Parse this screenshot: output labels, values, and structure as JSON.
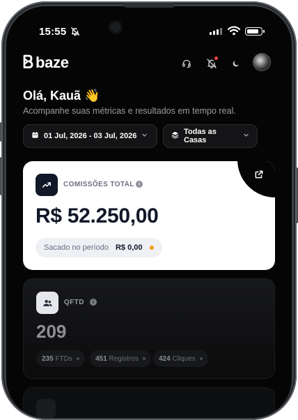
{
  "status_bar": {
    "time": "15:55"
  },
  "header": {
    "brand": "baze"
  },
  "greeting": {
    "title": "Olá, Kauã 👋",
    "subtitle": "Acompanhe suas métricas e resultados em tempo real."
  },
  "filters": {
    "date_range": "01 Jul, 2026 - 03 Jul, 2026",
    "casas": "Todas as Casas"
  },
  "commissions": {
    "label": "COMISSÕES TOTAL",
    "amount": "R$ 52.250,00",
    "withdrawn_label": "Sacado no período",
    "withdrawn_value": "R$ 0,00"
  },
  "qftd": {
    "label": "QFTD",
    "value": "209",
    "chips": [
      {
        "value": "235",
        "label": "FTDs"
      },
      {
        "value": "451",
        "label": "Registros"
      },
      {
        "value": "424",
        "label": "Cliques"
      }
    ]
  },
  "colors": {
    "background": "#050505",
    "card_light": "#ffffff",
    "accent_dot": "#f59e0b",
    "notification_dot": "#ef4444"
  }
}
